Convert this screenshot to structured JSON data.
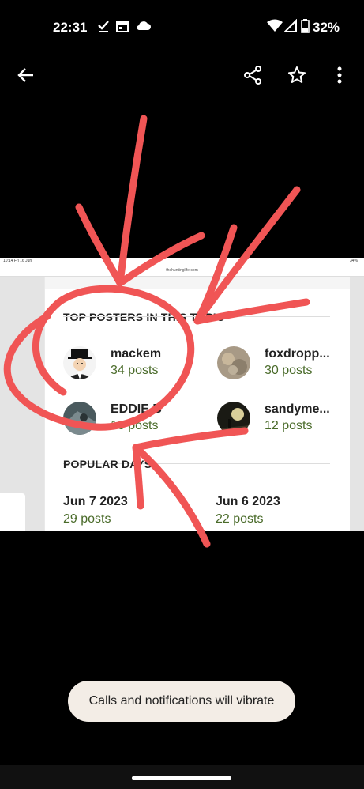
{
  "status_bar": {
    "time": "22:31",
    "battery": "32%",
    "icons": [
      "check-icon",
      "calendar-icon",
      "cloud-icon",
      "wifi-icon",
      "signal-icon",
      "battery-icon"
    ]
  },
  "top_bar": {
    "back_icon": "arrow-left-icon",
    "share_icon": "share-icon",
    "star_icon": "star-outline-icon",
    "more_icon": "more-vert-icon"
  },
  "photo": {
    "status_time": "10:14   Fri 16 Jun",
    "status_right": "34%",
    "url": "thehuntinglife.com",
    "top_posters_title": "TOP POSTERS IN THIS TOPIC",
    "posters": [
      {
        "name": "mackem",
        "posts": "34 posts"
      },
      {
        "name": "foxdropp...",
        "posts": "30 posts"
      },
      {
        "name": "EDDIE B",
        "posts": "18 posts"
      },
      {
        "name": "sandyme...",
        "posts": "12 posts"
      }
    ],
    "popular_days_title": "POPULAR DAYS",
    "days": [
      {
        "date": "Jun 7 2023",
        "posts": "29 posts"
      },
      {
        "date": "Jun 6 2023",
        "posts": "22 posts"
      }
    ]
  },
  "toast": {
    "text": "Calls and notifications will vibrate"
  },
  "colors": {
    "annotation_red": "#f05555",
    "post_count_green": "#4a6b2a",
    "toast_bg": "#f3ede6"
  }
}
